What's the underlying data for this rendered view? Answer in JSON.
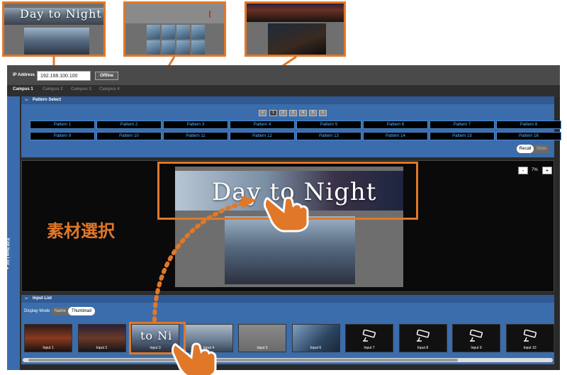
{
  "previews": {
    "p1_title": "Day to Night"
  },
  "app": {
    "ip_label": "IP Address",
    "ip_value": "192.168.100.100",
    "status_button": "Offline",
    "tabs": [
      "Campus 1",
      "Campus 2",
      "Campus 3",
      "Campus 4"
    ],
    "side_panel_label": "Edit Item List ▲"
  },
  "pattern_select": {
    "header": "Pattern Select",
    "pages": [
      "1",
      "2",
      "3",
      "4",
      "5"
    ],
    "pager_prev": "<",
    "pager_next": ">",
    "patterns_row1": [
      "Pattern 1",
      "Pattern 2",
      "Pattern 3",
      "Pattern 4",
      "Pattern 5",
      "Pattern 6",
      "Pattern 7",
      "Pattern 8"
    ],
    "patterns_row2": [
      "Pattern 9",
      "Pattern 10",
      "Pattern 11",
      "Pattern 12",
      "Pattern 13",
      "Pattern 14",
      "Pattern 15",
      "Pattern 16"
    ],
    "recall_label": "Recall",
    "store_label": "Store"
  },
  "preview": {
    "title": "Day to Night",
    "zoom_value": "7%",
    "zoom_minus": "-",
    "zoom_plus": "+"
  },
  "input_list": {
    "header": "Input List",
    "display_mode_label": "Display Mode",
    "mode_name": "Name",
    "mode_thumbnail": "Thumbnail",
    "inputs": [
      "Input 1",
      "Input 2",
      "Input 3",
      "Input 4",
      "Input 5",
      "Input 6",
      "Input 7",
      "Input 8",
      "Input 9",
      "Input 10"
    ],
    "tile3_overlay": "to Ni"
  },
  "annotation": {
    "text": "素材選択",
    "color": "#e07828"
  },
  "colors": {
    "accent": "#e07828",
    "panel_blue": "#3b6cab",
    "pattern_text": "#5fb6ff"
  }
}
